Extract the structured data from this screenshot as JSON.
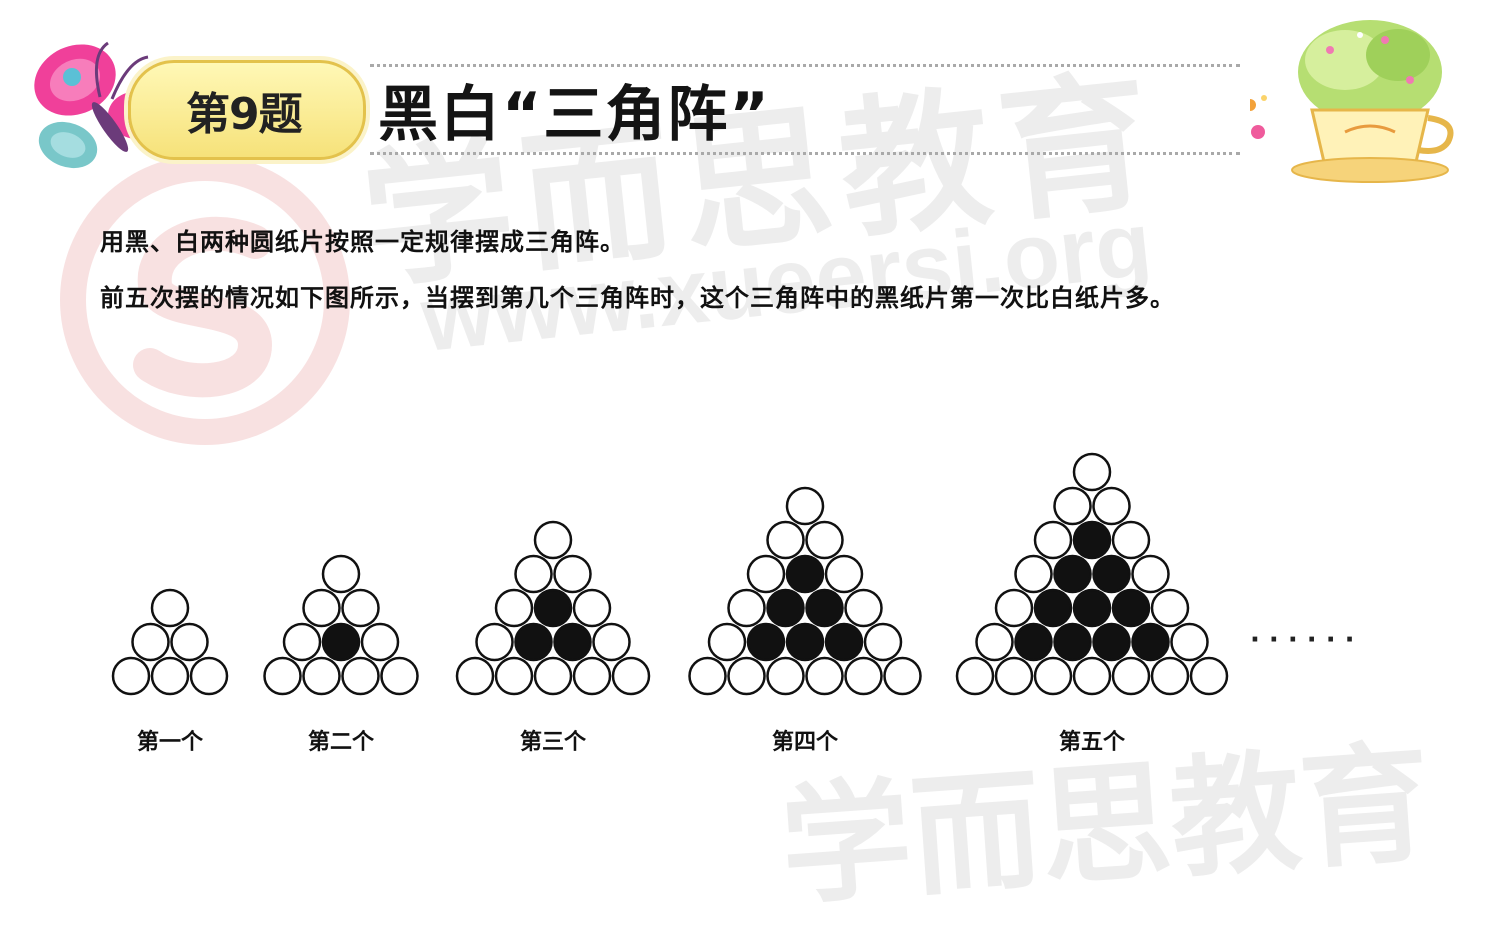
{
  "header": {
    "badge": "第9题",
    "title": "黑白“三角阵”"
  },
  "question": {
    "line1": "用黑、白两种圆纸片按照一定规律摆成三角阵。",
    "line2": "前五次摆的情况如下图所示，当摆到第几个三角阵时，这个三角阵中的黑纸片第一次比白纸片多。"
  },
  "watermark": {
    "brand": "学而思教育",
    "url": "www.xueersi.org"
  },
  "figures": [
    {
      "caption": "第一个",
      "rows": 3,
      "black_rows": 0
    },
    {
      "caption": "第二个",
      "rows": 4,
      "black_rows": 1
    },
    {
      "caption": "第三个",
      "rows": 5,
      "black_rows": 2
    },
    {
      "caption": "第四个",
      "rows": 6,
      "black_rows": 3
    },
    {
      "caption": "第五个",
      "rows": 7,
      "black_rows": 4
    }
  ],
  "continuation": "· · · · · ·",
  "colors": {
    "black_disc": "#111111",
    "white_disc": "#ffffff",
    "badge_fill": "#f8e98f",
    "watermark_red": "#e8b5b5"
  }
}
